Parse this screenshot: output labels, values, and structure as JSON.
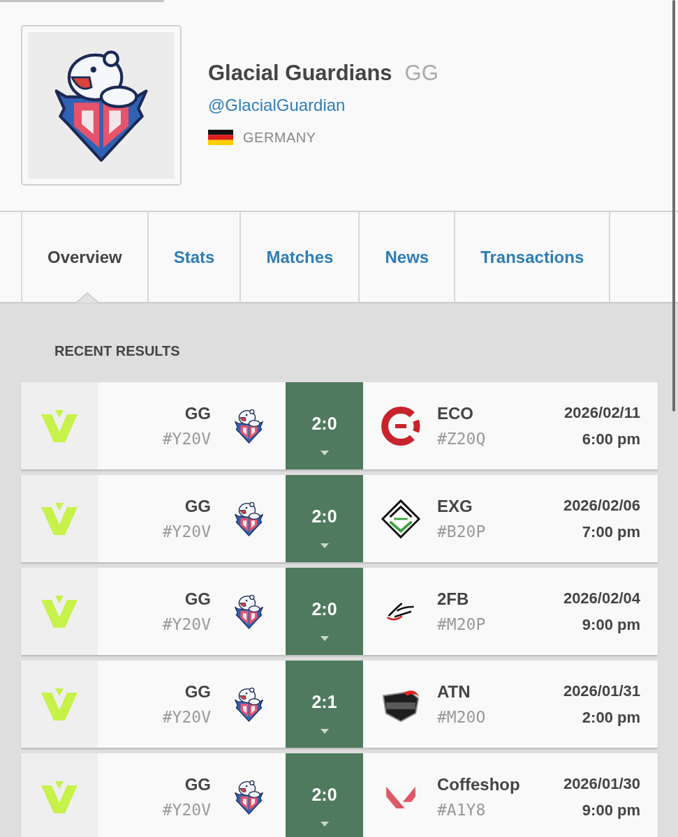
{
  "profile": {
    "name": "Glacial Guardians",
    "tag": "GG",
    "handle": "@GlacialGuardian",
    "country": "GERMANY"
  },
  "tabs": [
    {
      "label": "Overview",
      "selected": true
    },
    {
      "label": "Stats",
      "selected": false
    },
    {
      "label": "Matches",
      "selected": false
    },
    {
      "label": "News",
      "selected": false
    },
    {
      "label": "Transactions",
      "selected": false
    }
  ],
  "section_title": "RECENT RESULTS",
  "results": [
    {
      "team": {
        "name": "GG",
        "id": "#Y20V"
      },
      "score": "2:0",
      "opponent": {
        "name": "ECO",
        "id": "#Z20Q"
      },
      "date": "2026/02/11",
      "time": "6:00 pm"
    },
    {
      "team": {
        "name": "GG",
        "id": "#Y20V"
      },
      "score": "2:0",
      "opponent": {
        "name": "EXG",
        "id": "#B20P"
      },
      "date": "2026/02/06",
      "time": "7:00 pm"
    },
    {
      "team": {
        "name": "GG",
        "id": "#Y20V"
      },
      "score": "2:0",
      "opponent": {
        "name": "2FB",
        "id": "#M20P"
      },
      "date": "2026/02/04",
      "time": "9:00 pm"
    },
    {
      "team": {
        "name": "GG",
        "id": "#Y20V"
      },
      "score": "2:1",
      "opponent": {
        "name": "ATN",
        "id": "#M20O"
      },
      "date": "2026/01/31",
      "time": "2:00 pm"
    },
    {
      "team": {
        "name": "GG",
        "id": "#Y20V"
      },
      "score": "2:0",
      "opponent": {
        "name": "Coffeshop",
        "id": "#A1Y8"
      },
      "date": "2026/01/30",
      "time": "9:00 pm"
    }
  ]
}
